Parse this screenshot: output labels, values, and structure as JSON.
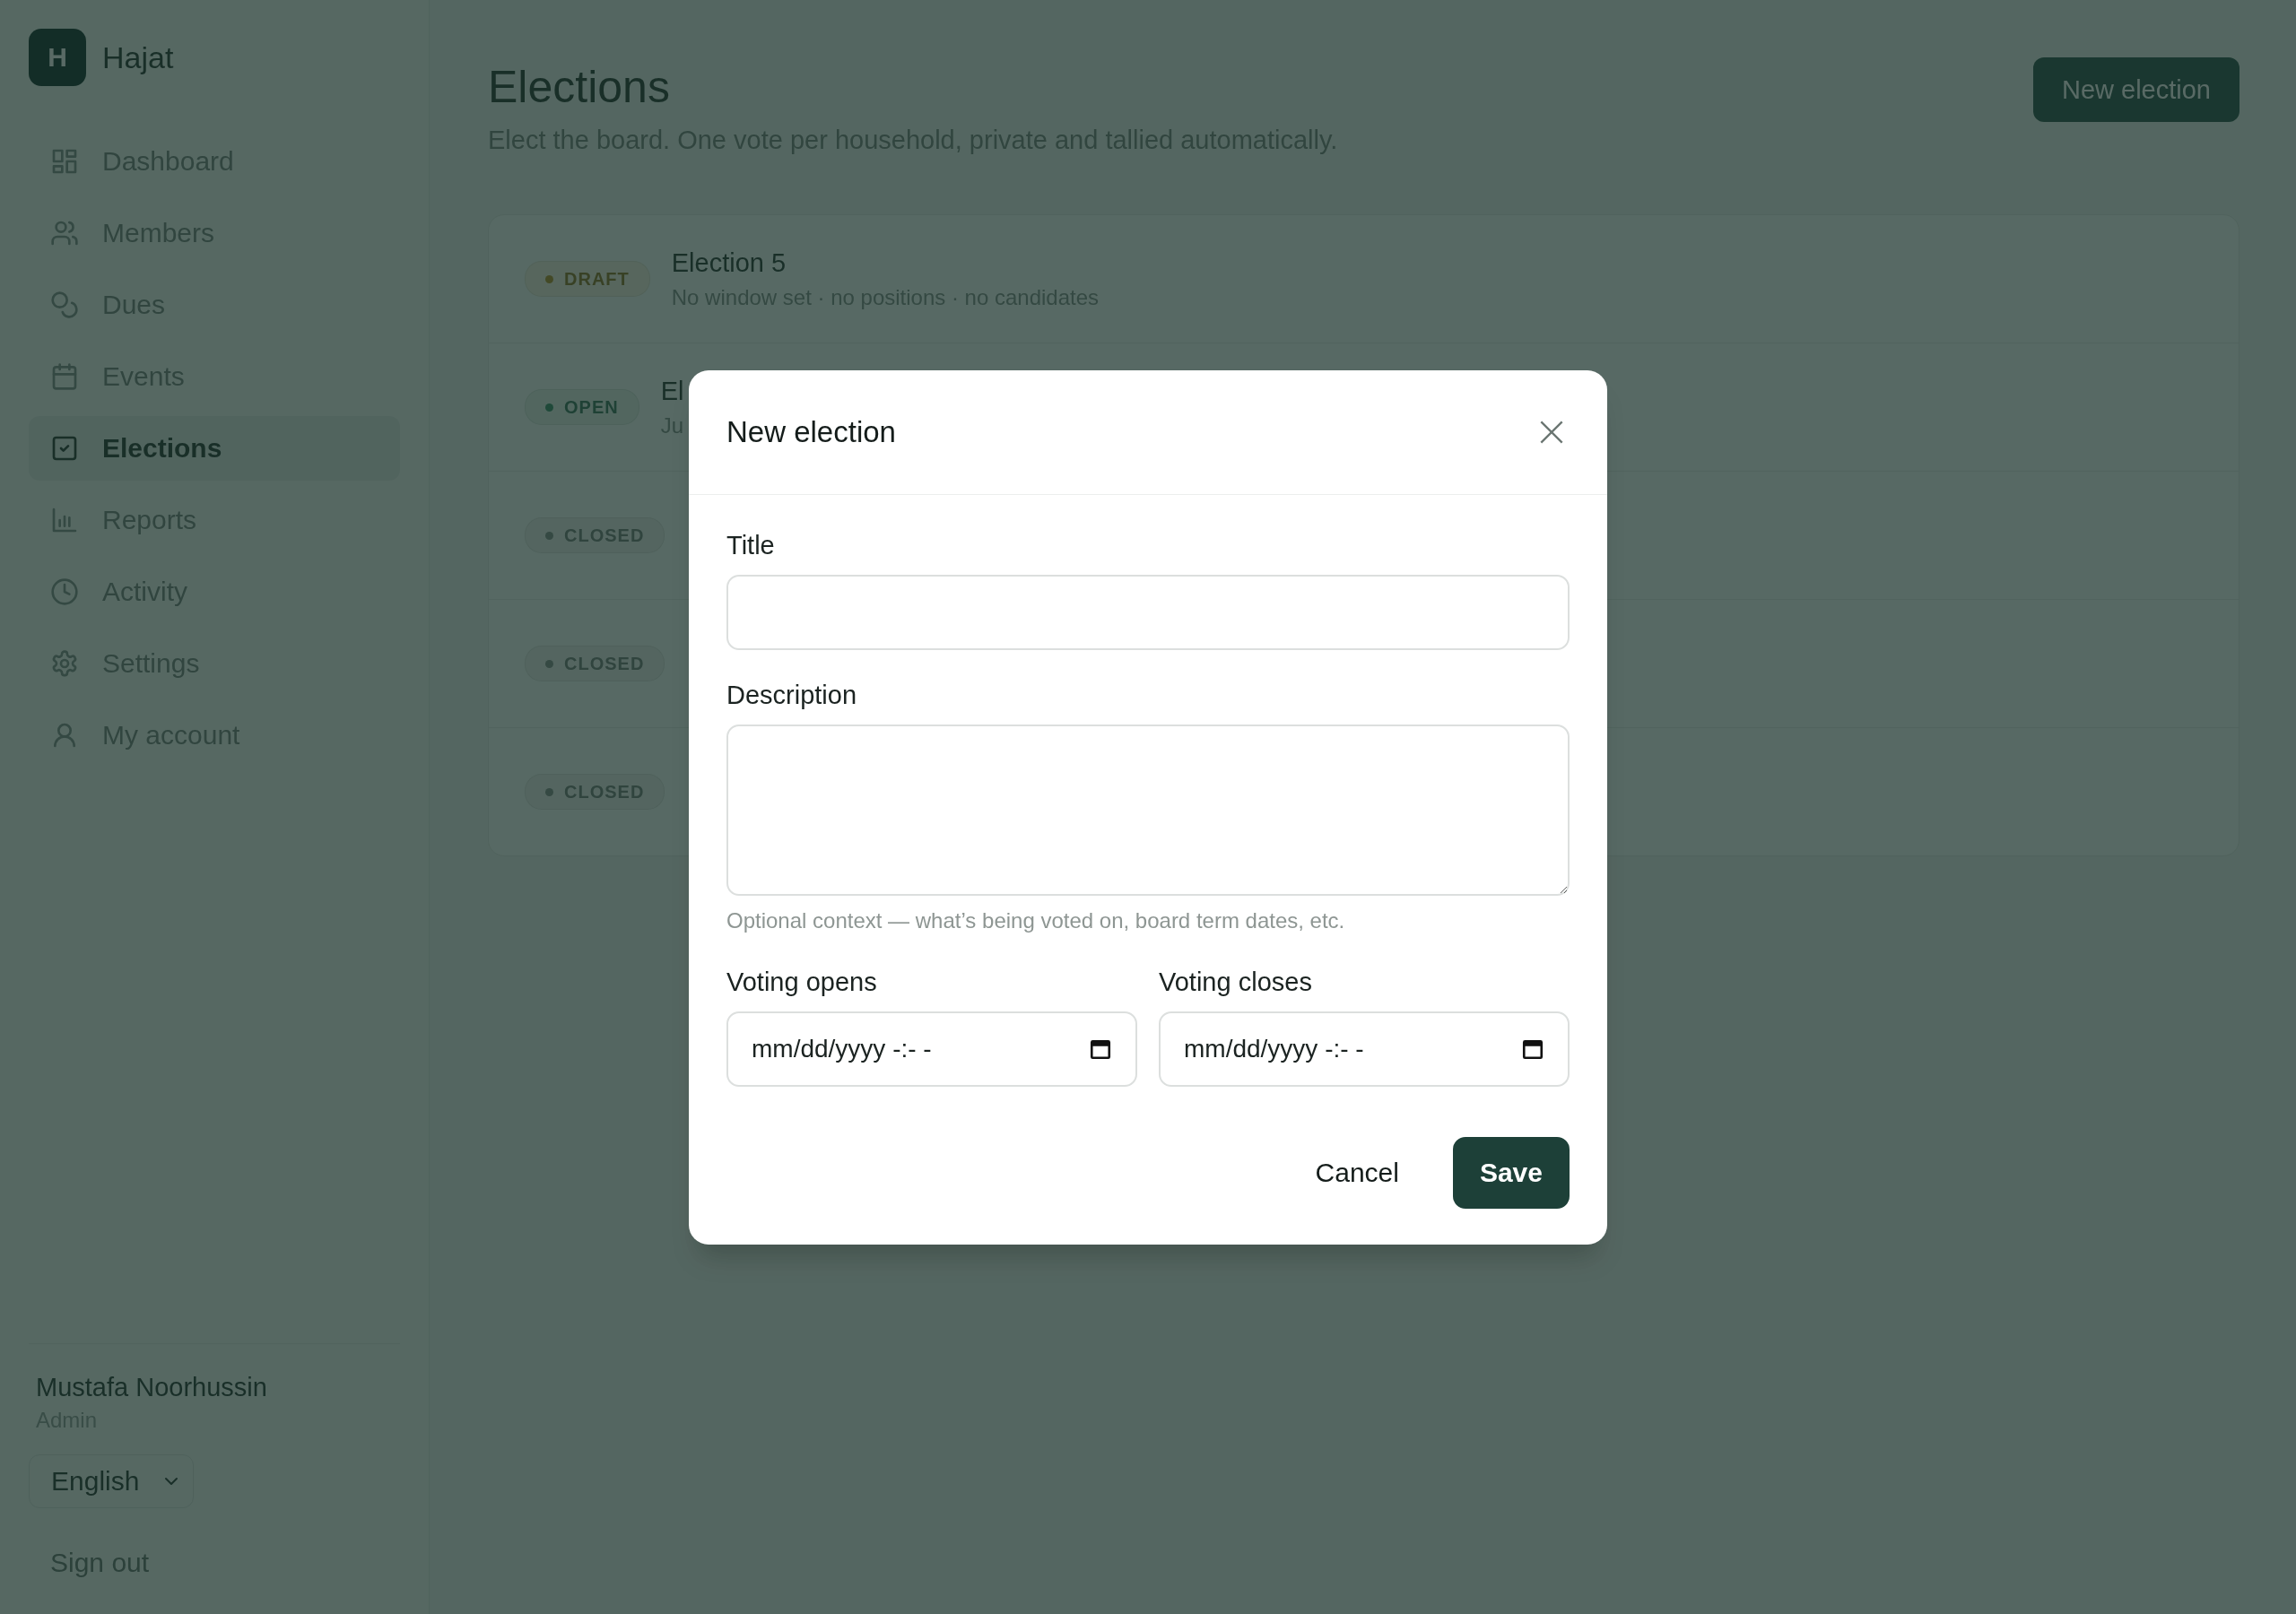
{
  "app": {
    "logo": "H",
    "name": "Hajat"
  },
  "nav": [
    {
      "label": "Dashboard",
      "selected": false
    },
    {
      "label": "Members",
      "selected": false
    },
    {
      "label": "Dues",
      "selected": false
    },
    {
      "label": "Events",
      "selected": false
    },
    {
      "label": "Elections",
      "selected": true
    },
    {
      "label": "Reports",
      "selected": false
    },
    {
      "label": "Activity",
      "selected": false
    },
    {
      "label": "Settings",
      "selected": false
    },
    {
      "label": "My account",
      "selected": false
    }
  ],
  "user": {
    "name": "Mustafa Noorhussin",
    "role": "Admin"
  },
  "language": {
    "value": "English"
  },
  "sign_out": "Sign out",
  "page": {
    "title": "Elections",
    "subtitle": "Elect the board. One vote per household, private and tallied automatically.",
    "action": "New election"
  },
  "elections": [
    {
      "status": "DRAFT",
      "kind": "draft",
      "title": "Election 5",
      "details": "No window set · no positions · no candidates"
    },
    {
      "status": "OPEN",
      "kind": "open",
      "title": "El",
      "details": "Ju"
    },
    {
      "status": "CLOSED",
      "kind": "closed"
    },
    {
      "status": "CLOSED",
      "kind": "closed"
    },
    {
      "status": "CLOSED",
      "kind": "closed"
    }
  ],
  "modal": {
    "title": "New election",
    "fields": [
      {
        "label": "Title",
        "kind": "text"
      },
      {
        "label": "Description",
        "kind": "textarea",
        "hint": "Optional context — what’s being voted on, board term dates, etc."
      }
    ],
    "dates": [
      {
        "label": "Voting opens",
        "placeholder": "mm/dd/yyyy -:- -"
      },
      {
        "label": "Voting closes",
        "placeholder": "mm/dd/yyyy -:- -"
      }
    ],
    "buttons": [
      {
        "label": "Cancel",
        "kind": "secondary"
      },
      {
        "label": "Save",
        "kind": "primary"
      }
    ]
  }
}
